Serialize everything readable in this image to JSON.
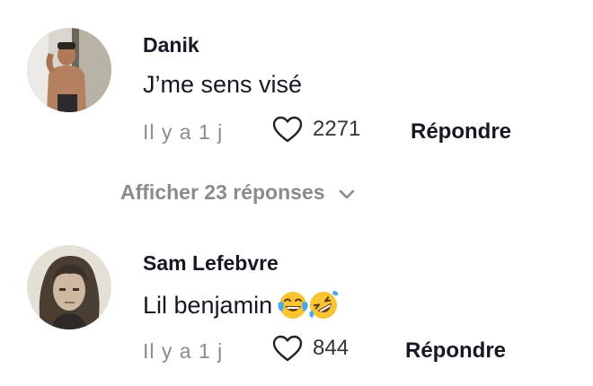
{
  "comments": [
    {
      "username": "Danik",
      "text": "J’me sens visé",
      "emojis": [],
      "time": "Il y a 1 j",
      "likes": "2271",
      "reply_label": "Répondre",
      "liked": false
    },
    {
      "username": "Sam Lefebvre",
      "text": "Lil benjamin",
      "emojis": [
        "face-with-tears-of-joy",
        "rolling-on-floor-laughing"
      ],
      "time": "Il y a 1 j",
      "likes": "844",
      "reply_label": "Répondre",
      "liked": false
    }
  ],
  "show_replies": {
    "label": "Afficher 23 réponses",
    "icon": "chevron-down-icon"
  },
  "colors": {
    "text_primary": "#161823",
    "text_secondary": "#8a8b91"
  }
}
